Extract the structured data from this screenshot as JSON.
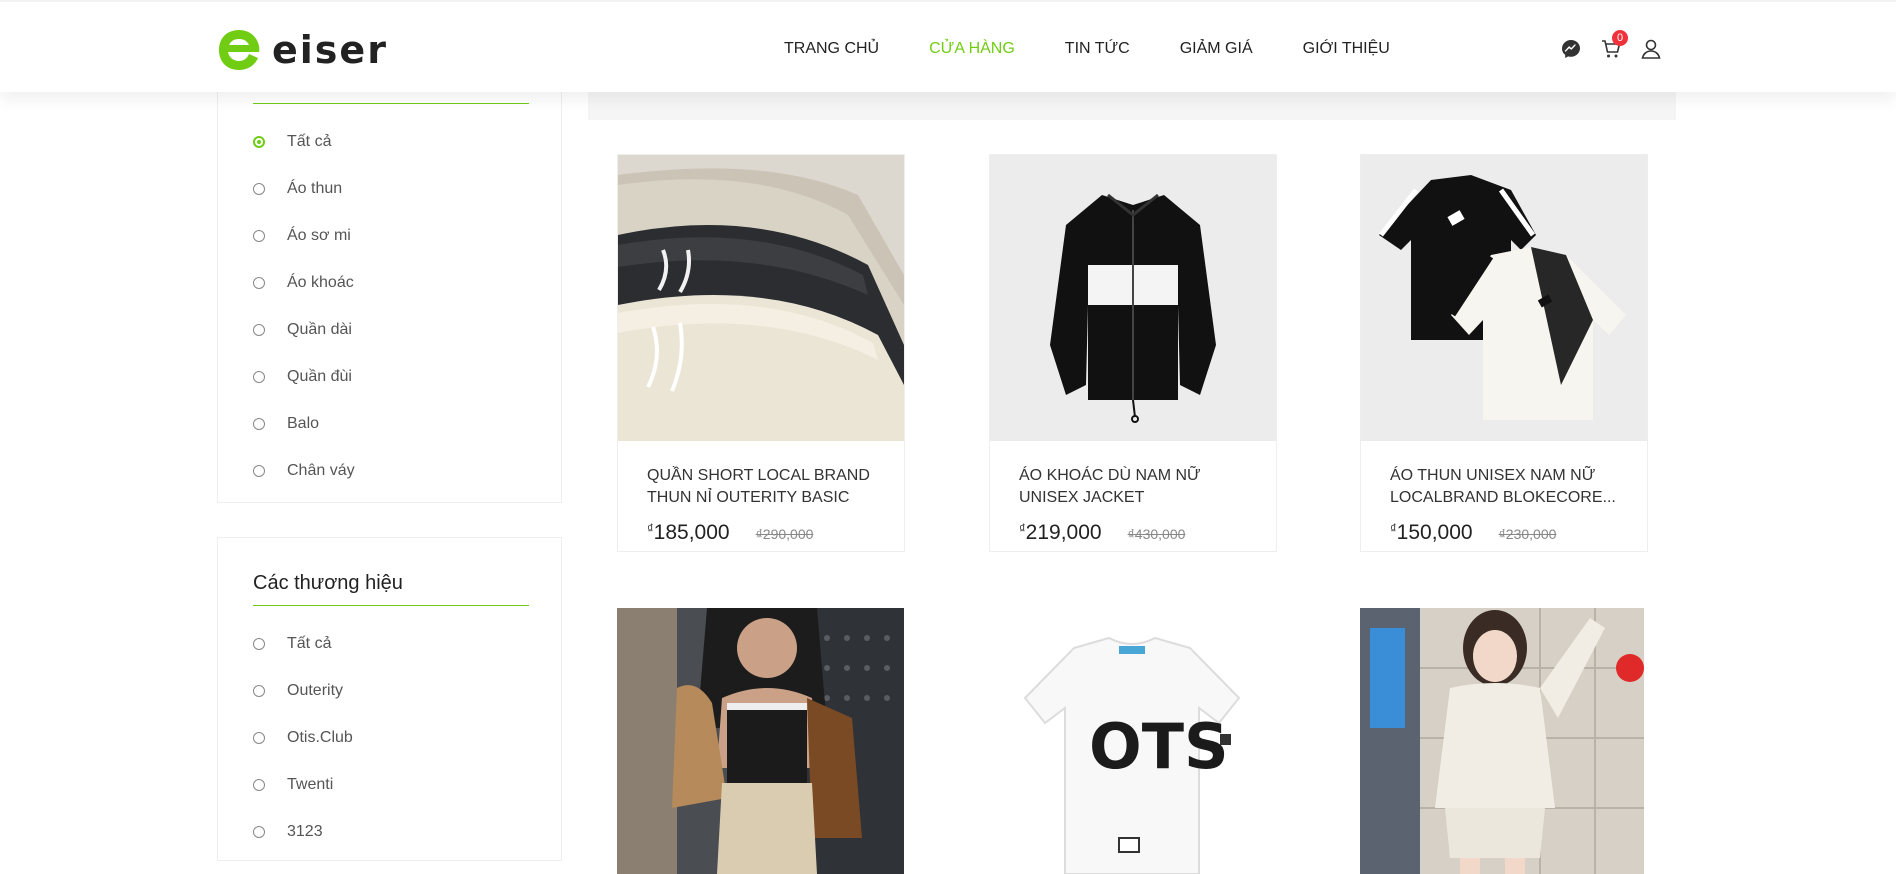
{
  "brand": {
    "name": "eiser",
    "accent": "#71cd14"
  },
  "nav": [
    {
      "label": "TRANG CHỦ",
      "active": false
    },
    {
      "label": "CỬA HÀNG",
      "active": true
    },
    {
      "label": "TIN TỨC",
      "active": false
    },
    {
      "label": "GIẢM GIÁ",
      "active": false
    },
    {
      "label": "GIỚI THIỆU",
      "active": false
    }
  ],
  "header_icons": {
    "messenger": "messenger-icon",
    "cart": "cart-icon",
    "cart_count": "0",
    "user": "user-icon"
  },
  "categories": {
    "items": [
      "Tất cả",
      "Áo thun",
      "Áo sơ mi",
      "Áo khoác",
      "Quần dài",
      "Quần đùi",
      "Balo",
      "Chân váy"
    ],
    "selected": 0
  },
  "brands": {
    "title": "Các thương hiệu",
    "items": [
      "Tất cả",
      "Outerity",
      "Otis.Club",
      "Twenti",
      "3123"
    ]
  },
  "products": [
    {
      "title": "QUẦN SHORT LOCAL BRAND THUN NỈ OUTERITY BASIC",
      "currency": "₫",
      "price": "185,000",
      "old_price": "₫290,000",
      "image": "shorts-photo"
    },
    {
      "title": "ÁO KHOÁC DÙ NAM NỮ UNISEX JACKET",
      "currency": "₫",
      "price": "219,000",
      "old_price": "₫430,000",
      "image": "jacket-photo"
    },
    {
      "title": "ÁO THUN UNISEX NAM NỮ LOCALBRAND BLOKECORE...",
      "currency": "₫",
      "price": "150,000",
      "old_price": "₫230,000",
      "image": "tshirt-photo"
    },
    {
      "title": "",
      "image": "model-tanktop-photo"
    },
    {
      "title": "",
      "image": "ots-tshirt-photo",
      "print": "OTS"
    },
    {
      "title": "",
      "image": "model-cardigan-photo"
    }
  ]
}
